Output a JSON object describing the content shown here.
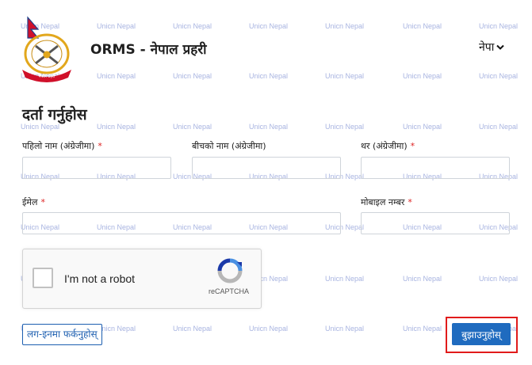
{
  "header": {
    "app_title": "ORMS - नेपाल प्रहरी",
    "language_label": "नेपा"
  },
  "page": {
    "title": "दर्ता गर्नुहोस"
  },
  "form": {
    "first_name_label": "पहिलो नाम (अंग्रेजीमा)",
    "middle_name_label": "बीचको नाम (अंग्रेजीमा)",
    "last_name_label": "थर (अंग्रेजीमा)",
    "email_label": "ईमेल",
    "mobile_label": "मोबाइल नम्बर",
    "required_mark": "*",
    "first_name_value": "",
    "middle_name_value": "",
    "last_name_value": "",
    "email_value": "",
    "mobile_value": ""
  },
  "captcha": {
    "label": "I'm not a robot",
    "brand": "reCAPTCHA"
  },
  "actions": {
    "back_to_login": "लग-इनमा फर्कनुहोस्",
    "submit": "बुझाउनुहोस्"
  },
  "watermark": {
    "text": "Unicn Nepal"
  },
  "colors": {
    "primary": "#1f6bbf",
    "highlight": "#e11b1b",
    "required": "#d22222",
    "watermark": "#8a9ad6"
  }
}
